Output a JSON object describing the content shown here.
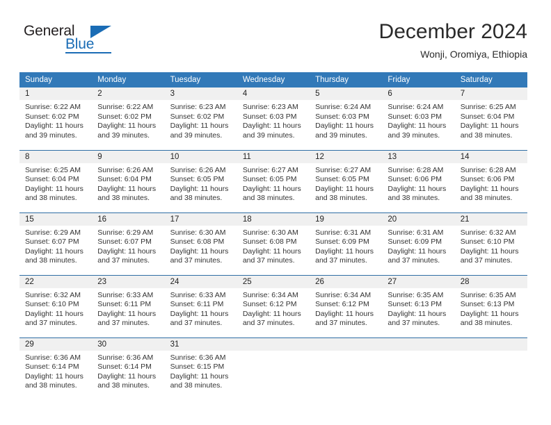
{
  "brand": {
    "name_part1": "General",
    "name_part2": "Blue",
    "accent_color": "#1a6cb5",
    "triangle_icon": "triangle-icon"
  },
  "header": {
    "title": "December 2024",
    "location": "Wonji, Oromiya, Ethiopia"
  },
  "calendar": {
    "header_bg": "#3279b8",
    "row_divider_color": "#2e6da4",
    "daynum_band_bg": "#f0f0f0",
    "weekday_headers": [
      "Sunday",
      "Monday",
      "Tuesday",
      "Wednesday",
      "Thursday",
      "Friday",
      "Saturday"
    ],
    "labels": {
      "sunrise": "Sunrise:",
      "sunset": "Sunset:",
      "daylight": "Daylight:"
    },
    "weeks": [
      [
        {
          "day": "1",
          "sunrise": "Sunrise: 6:22 AM",
          "sunset": "Sunset: 6:02 PM",
          "daylight_line1": "Daylight: 11 hours",
          "daylight_line2": "and 39 minutes."
        },
        {
          "day": "2",
          "sunrise": "Sunrise: 6:22 AM",
          "sunset": "Sunset: 6:02 PM",
          "daylight_line1": "Daylight: 11 hours",
          "daylight_line2": "and 39 minutes."
        },
        {
          "day": "3",
          "sunrise": "Sunrise: 6:23 AM",
          "sunset": "Sunset: 6:02 PM",
          "daylight_line1": "Daylight: 11 hours",
          "daylight_line2": "and 39 minutes."
        },
        {
          "day": "4",
          "sunrise": "Sunrise: 6:23 AM",
          "sunset": "Sunset: 6:03 PM",
          "daylight_line1": "Daylight: 11 hours",
          "daylight_line2": "and 39 minutes."
        },
        {
          "day": "5",
          "sunrise": "Sunrise: 6:24 AM",
          "sunset": "Sunset: 6:03 PM",
          "daylight_line1": "Daylight: 11 hours",
          "daylight_line2": "and 39 minutes."
        },
        {
          "day": "6",
          "sunrise": "Sunrise: 6:24 AM",
          "sunset": "Sunset: 6:03 PM",
          "daylight_line1": "Daylight: 11 hours",
          "daylight_line2": "and 39 minutes."
        },
        {
          "day": "7",
          "sunrise": "Sunrise: 6:25 AM",
          "sunset": "Sunset: 6:04 PM",
          "daylight_line1": "Daylight: 11 hours",
          "daylight_line2": "and 38 minutes."
        }
      ],
      [
        {
          "day": "8",
          "sunrise": "Sunrise: 6:25 AM",
          "sunset": "Sunset: 6:04 PM",
          "daylight_line1": "Daylight: 11 hours",
          "daylight_line2": "and 38 minutes."
        },
        {
          "day": "9",
          "sunrise": "Sunrise: 6:26 AM",
          "sunset": "Sunset: 6:04 PM",
          "daylight_line1": "Daylight: 11 hours",
          "daylight_line2": "and 38 minutes."
        },
        {
          "day": "10",
          "sunrise": "Sunrise: 6:26 AM",
          "sunset": "Sunset: 6:05 PM",
          "daylight_line1": "Daylight: 11 hours",
          "daylight_line2": "and 38 minutes."
        },
        {
          "day": "11",
          "sunrise": "Sunrise: 6:27 AM",
          "sunset": "Sunset: 6:05 PM",
          "daylight_line1": "Daylight: 11 hours",
          "daylight_line2": "and 38 minutes."
        },
        {
          "day": "12",
          "sunrise": "Sunrise: 6:27 AM",
          "sunset": "Sunset: 6:05 PM",
          "daylight_line1": "Daylight: 11 hours",
          "daylight_line2": "and 38 minutes."
        },
        {
          "day": "13",
          "sunrise": "Sunrise: 6:28 AM",
          "sunset": "Sunset: 6:06 PM",
          "daylight_line1": "Daylight: 11 hours",
          "daylight_line2": "and 38 minutes."
        },
        {
          "day": "14",
          "sunrise": "Sunrise: 6:28 AM",
          "sunset": "Sunset: 6:06 PM",
          "daylight_line1": "Daylight: 11 hours",
          "daylight_line2": "and 38 minutes."
        }
      ],
      [
        {
          "day": "15",
          "sunrise": "Sunrise: 6:29 AM",
          "sunset": "Sunset: 6:07 PM",
          "daylight_line1": "Daylight: 11 hours",
          "daylight_line2": "and 38 minutes."
        },
        {
          "day": "16",
          "sunrise": "Sunrise: 6:29 AM",
          "sunset": "Sunset: 6:07 PM",
          "daylight_line1": "Daylight: 11 hours",
          "daylight_line2": "and 37 minutes."
        },
        {
          "day": "17",
          "sunrise": "Sunrise: 6:30 AM",
          "sunset": "Sunset: 6:08 PM",
          "daylight_line1": "Daylight: 11 hours",
          "daylight_line2": "and 37 minutes."
        },
        {
          "day": "18",
          "sunrise": "Sunrise: 6:30 AM",
          "sunset": "Sunset: 6:08 PM",
          "daylight_line1": "Daylight: 11 hours",
          "daylight_line2": "and 37 minutes."
        },
        {
          "day": "19",
          "sunrise": "Sunrise: 6:31 AM",
          "sunset": "Sunset: 6:09 PM",
          "daylight_line1": "Daylight: 11 hours",
          "daylight_line2": "and 37 minutes."
        },
        {
          "day": "20",
          "sunrise": "Sunrise: 6:31 AM",
          "sunset": "Sunset: 6:09 PM",
          "daylight_line1": "Daylight: 11 hours",
          "daylight_line2": "and 37 minutes."
        },
        {
          "day": "21",
          "sunrise": "Sunrise: 6:32 AM",
          "sunset": "Sunset: 6:10 PM",
          "daylight_line1": "Daylight: 11 hours",
          "daylight_line2": "and 37 minutes."
        }
      ],
      [
        {
          "day": "22",
          "sunrise": "Sunrise: 6:32 AM",
          "sunset": "Sunset: 6:10 PM",
          "daylight_line1": "Daylight: 11 hours",
          "daylight_line2": "and 37 minutes."
        },
        {
          "day": "23",
          "sunrise": "Sunrise: 6:33 AM",
          "sunset": "Sunset: 6:11 PM",
          "daylight_line1": "Daylight: 11 hours",
          "daylight_line2": "and 37 minutes."
        },
        {
          "day": "24",
          "sunrise": "Sunrise: 6:33 AM",
          "sunset": "Sunset: 6:11 PM",
          "daylight_line1": "Daylight: 11 hours",
          "daylight_line2": "and 37 minutes."
        },
        {
          "day": "25",
          "sunrise": "Sunrise: 6:34 AM",
          "sunset": "Sunset: 6:12 PM",
          "daylight_line1": "Daylight: 11 hours",
          "daylight_line2": "and 37 minutes."
        },
        {
          "day": "26",
          "sunrise": "Sunrise: 6:34 AM",
          "sunset": "Sunset: 6:12 PM",
          "daylight_line1": "Daylight: 11 hours",
          "daylight_line2": "and 37 minutes."
        },
        {
          "day": "27",
          "sunrise": "Sunrise: 6:35 AM",
          "sunset": "Sunset: 6:13 PM",
          "daylight_line1": "Daylight: 11 hours",
          "daylight_line2": "and 37 minutes."
        },
        {
          "day": "28",
          "sunrise": "Sunrise: 6:35 AM",
          "sunset": "Sunset: 6:13 PM",
          "daylight_line1": "Daylight: 11 hours",
          "daylight_line2": "and 38 minutes."
        }
      ],
      [
        {
          "day": "29",
          "sunrise": "Sunrise: 6:36 AM",
          "sunset": "Sunset: 6:14 PM",
          "daylight_line1": "Daylight: 11 hours",
          "daylight_line2": "and 38 minutes."
        },
        {
          "day": "30",
          "sunrise": "Sunrise: 6:36 AM",
          "sunset": "Sunset: 6:14 PM",
          "daylight_line1": "Daylight: 11 hours",
          "daylight_line2": "and 38 minutes."
        },
        {
          "day": "31",
          "sunrise": "Sunrise: 6:36 AM",
          "sunset": "Sunset: 6:15 PM",
          "daylight_line1": "Daylight: 11 hours",
          "daylight_line2": "and 38 minutes."
        },
        {
          "day": "",
          "sunrise": "",
          "sunset": "",
          "daylight_line1": "",
          "daylight_line2": ""
        },
        {
          "day": "",
          "sunrise": "",
          "sunset": "",
          "daylight_line1": "",
          "daylight_line2": ""
        },
        {
          "day": "",
          "sunrise": "",
          "sunset": "",
          "daylight_line1": "",
          "daylight_line2": ""
        },
        {
          "day": "",
          "sunrise": "",
          "sunset": "",
          "daylight_line1": "",
          "daylight_line2": ""
        }
      ]
    ]
  }
}
